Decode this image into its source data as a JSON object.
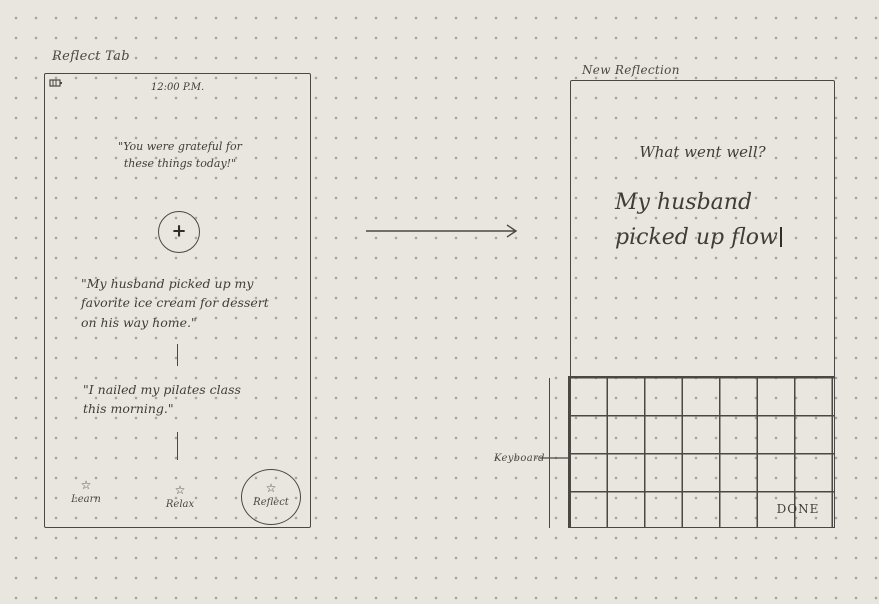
{
  "left_sketch": {
    "caption": "Reflect Tab",
    "status_time": "12:00 P.M.",
    "prompt": "\"You were grateful for these things today!\"",
    "add_symbol": "+",
    "entry_1": "\"My husband picked up my favorite ice cream for dessert on his way home.\"",
    "entry_2": "\"I nailed my pilates class this morning.\"",
    "tabs": [
      {
        "label": "Learn",
        "icon": "star-icon"
      },
      {
        "label": "Relax",
        "icon": "star-icon"
      },
      {
        "label": "Reflect",
        "icon": "star-icon"
      }
    ]
  },
  "right_sketch": {
    "caption": "New Reflection",
    "question": "What went well?",
    "typed_text": "My husband picked up flow",
    "keyboard_label": "Keyboard",
    "done_label": "DONE"
  },
  "colors": {
    "paper": "#e9e6df",
    "pencil": "#4a4844"
  }
}
